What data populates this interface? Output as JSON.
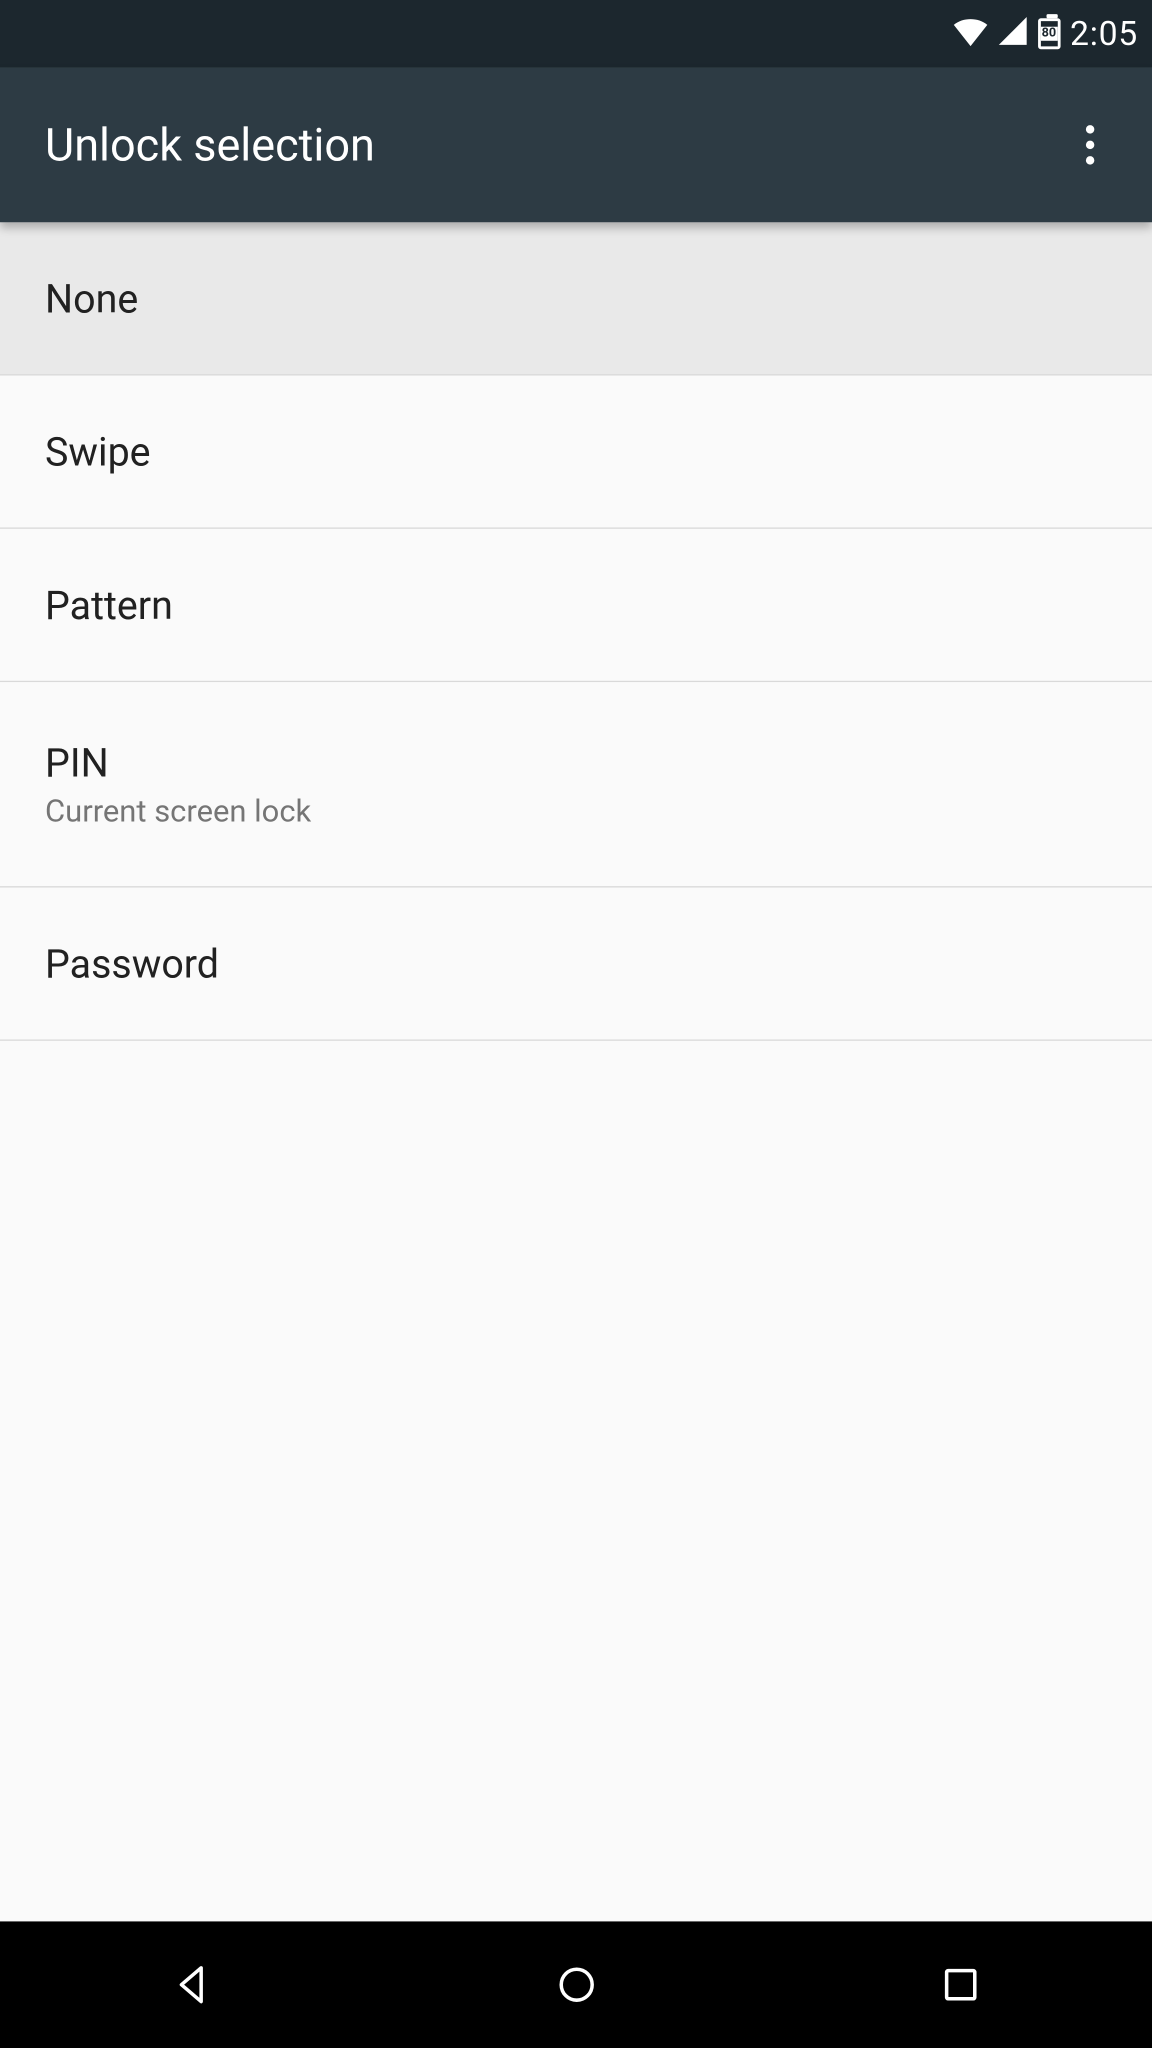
{
  "status": {
    "battery": "80",
    "time": "2:05"
  },
  "header": {
    "title": "Unlock selection"
  },
  "options": {
    "none": {
      "label": "None"
    },
    "swipe": {
      "label": "Swipe"
    },
    "pattern": {
      "label": "Pattern"
    },
    "pin": {
      "label": "PIN",
      "subtitle": "Current screen lock"
    },
    "password": {
      "label": "Password"
    }
  }
}
